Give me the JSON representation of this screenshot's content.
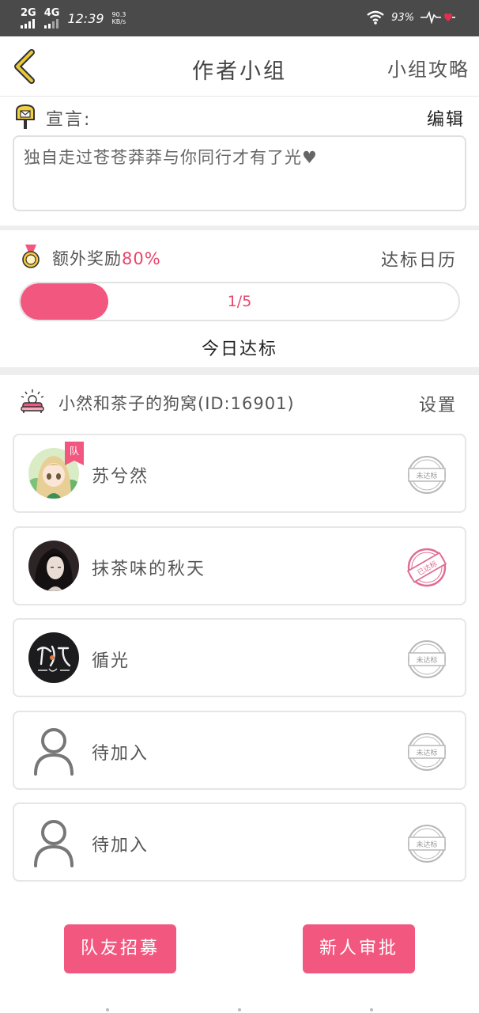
{
  "status_bar": {
    "net1": "2G",
    "net2": "4G",
    "time": "12:39",
    "speed_value": "90.3",
    "speed_unit": "KB/s",
    "battery": "93%"
  },
  "header": {
    "title": "作者小组",
    "strategy_label": "小组攻略"
  },
  "declaration": {
    "label": "宣言:",
    "edit_label": "编辑",
    "text": "独自走过苍苍莽莽与你同行才有了光♥"
  },
  "reward": {
    "label": "额外奖励",
    "percent": "80%",
    "calendar_label": "达标日历",
    "progress_text": "1/5",
    "progress_fraction": 0.2,
    "today_label": "今日达标"
  },
  "group": {
    "name": "小然和茶子的狗窝(ID:16901)",
    "settings_label": "设置"
  },
  "members": [
    {
      "name": "苏兮然",
      "badge": "队",
      "stamp": "未达标",
      "achieved": false,
      "avatar": "anime-girl"
    },
    {
      "name": "抹茶味的秋天",
      "stamp": "已达标",
      "achieved": true,
      "avatar": "dark-portrait"
    },
    {
      "name": "循光",
      "stamp": "未达标",
      "achieved": false,
      "avatar": "calligraphy"
    },
    {
      "name": "待加入",
      "stamp": "未达标",
      "achieved": false,
      "avatar": "placeholder"
    },
    {
      "name": "待加入",
      "stamp": "未达标",
      "achieved": false,
      "avatar": "placeholder"
    }
  ],
  "actions": {
    "recruit_label": "队友招募",
    "approve_label": "新人审批"
  },
  "colors": {
    "accent": "#f2587f",
    "status_bar": "#4a4a4a",
    "achieved_stamp": "#e06b95",
    "pending_stamp": "#b8b8b8"
  }
}
